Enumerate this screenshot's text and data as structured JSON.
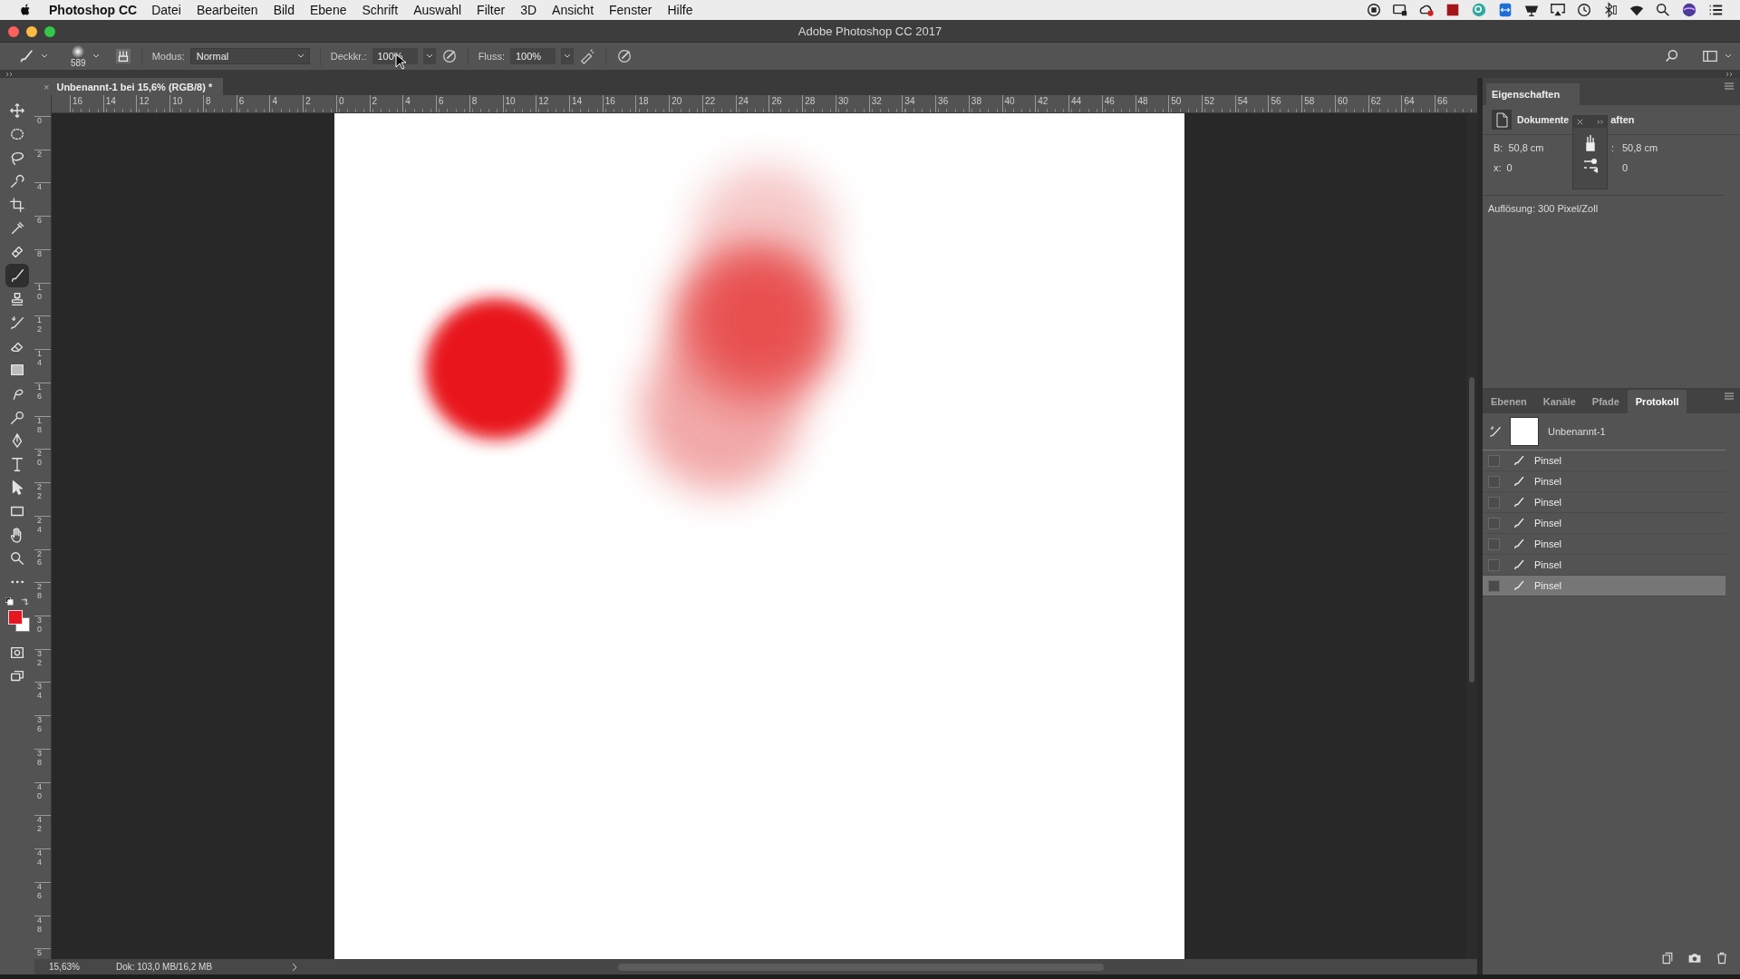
{
  "menu_bar": {
    "app_name": "Photoshop CC",
    "items": [
      "Datei",
      "Bearbeiten",
      "Bild",
      "Ebene",
      "Schrift",
      "Auswahl",
      "Filter",
      "3D",
      "Ansicht",
      "Fenster",
      "Hilfe"
    ]
  },
  "window": {
    "title": "Adobe Photoshop CC 2017"
  },
  "options_bar": {
    "brush_size": "589",
    "mode_label": "Modus:",
    "mode_value": "Normal",
    "opacity_label": "Deckkr.:",
    "opacity_value": "100%",
    "flow_label": "Fluss:",
    "flow_value": "100%"
  },
  "document_tab": {
    "close": "×",
    "title": "Unbenannt-1 bei 15,6% (RGB/8) *"
  },
  "tools": [
    {
      "kind": "move",
      "selected": false
    },
    {
      "kind": "marquee",
      "selected": false
    },
    {
      "kind": "lasso",
      "selected": false
    },
    {
      "kind": "quick_select",
      "selected": false
    },
    {
      "kind": "crop",
      "selected": false
    },
    {
      "kind": "eyedropper",
      "selected": false
    },
    {
      "kind": "healing",
      "selected": false
    },
    {
      "kind": "brush",
      "selected": true
    },
    {
      "kind": "stamp",
      "selected": false
    },
    {
      "kind": "history_brush",
      "selected": false
    },
    {
      "kind": "eraser",
      "selected": false
    },
    {
      "kind": "gradient",
      "selected": false
    },
    {
      "kind": "smudge",
      "selected": false
    },
    {
      "kind": "dodge",
      "selected": false
    },
    {
      "kind": "pen",
      "selected": false
    },
    {
      "kind": "type",
      "selected": false
    },
    {
      "kind": "path_select",
      "selected": false
    },
    {
      "kind": "rectangle",
      "selected": false
    },
    {
      "kind": "hand",
      "selected": false
    },
    {
      "kind": "zoom",
      "selected": false
    },
    {
      "kind": "more",
      "selected": false
    }
  ],
  "view_tools": [
    {
      "kind": "quick_mask",
      "selected": false
    },
    {
      "kind": "screen_mode",
      "selected": false
    }
  ],
  "rulers": {
    "horizontal": [
      "16",
      "14",
      "12",
      "10",
      "8",
      "6",
      "4",
      "2",
      "0",
      "2",
      "4",
      "6",
      "8",
      "10",
      "12",
      "14",
      "16",
      "18",
      "20",
      "22",
      "24",
      "26",
      "28",
      "30",
      "32",
      "34",
      "36",
      "38",
      "40",
      "42",
      "44",
      "46",
      "48",
      "50",
      "52",
      "54",
      "56",
      "58",
      "60",
      "62",
      "64",
      "66"
    ],
    "vertical": [
      "0",
      "2",
      "4",
      "6",
      "8",
      "10",
      "12",
      "14",
      "16",
      "18",
      "20",
      "22",
      "24",
      "26",
      "28",
      "30",
      "32",
      "34",
      "36",
      "38",
      "40",
      "42",
      "44",
      "46",
      "48",
      "5"
    ]
  },
  "properties_panel": {
    "title": "Eigenschaften",
    "section_title_start": "Dokumente",
    "section_title_end": "aften",
    "fields_left": [
      {
        "label": "B:",
        "value": "50,8 cm"
      },
      {
        "label": "x:",
        "value": "0"
      }
    ],
    "fields_right": [
      {
        "label": ":",
        "value": "50,8 cm"
      },
      {
        "value": "0"
      }
    ],
    "resolution": "Auflösung: 300 Pixel/Zoll"
  },
  "history_panel": {
    "tabs": [
      {
        "label": "Ebenen",
        "selected": false
      },
      {
        "label": "Kanäle",
        "selected": false
      },
      {
        "label": "Pfade",
        "selected": false
      },
      {
        "label": "Protokoll",
        "selected": true
      }
    ],
    "snapshot": "Unbenannt-1",
    "states": [
      {
        "name": "Pinsel",
        "selected": false
      },
      {
        "name": "Pinsel",
        "selected": false
      },
      {
        "name": "Pinsel",
        "selected": false
      },
      {
        "name": "Pinsel",
        "selected": false
      },
      {
        "name": "Pinsel",
        "selected": false
      },
      {
        "name": "Pinsel",
        "selected": false
      },
      {
        "name": "Pinsel",
        "selected": true
      }
    ]
  },
  "status_bar": {
    "zoom": "15,63%",
    "doc_info": "Dok: 103,0 MB/16,2 MB"
  }
}
